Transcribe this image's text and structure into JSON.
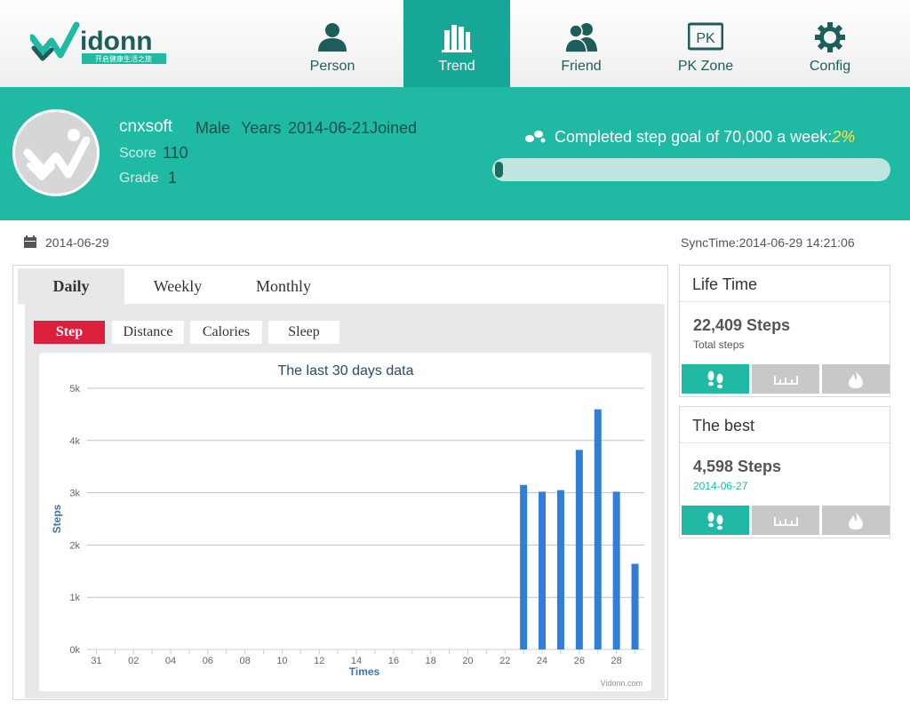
{
  "brand": {
    "name": "idonn",
    "slogan": "开启健康生活之旅"
  },
  "nav": [
    {
      "label": "Person",
      "icon": "person-icon",
      "active": false
    },
    {
      "label": "Trend",
      "icon": "bar-chart-icon",
      "active": true
    },
    {
      "label": "Friend",
      "icon": "friends-icon",
      "active": false
    },
    {
      "label": "PK Zone",
      "icon": "pk-icon",
      "icon_text": "PK",
      "active": false
    },
    {
      "label": "Config",
      "icon": "gear-icon",
      "active": false
    }
  ],
  "profile": {
    "username": "cnxsoft",
    "gender": "Male",
    "years_label": "Years",
    "joined": "2014-06-21Joined",
    "score_label": "Score",
    "score": "110",
    "grade_label": "Grade",
    "grade": "1"
  },
  "goal": {
    "text": "Completed step goal of 70,000 a week:",
    "percent_label": "2%",
    "progress": 0.02
  },
  "date": "2014-06-29",
  "sync": "SyncTime:2014-06-29 14:21:06",
  "tabs": [
    "Daily",
    "Weekly",
    "Monthly"
  ],
  "subtabs": [
    "Step",
    "Distance",
    "Calories",
    "Sleep"
  ],
  "life_time": {
    "title": "Life Time",
    "value": "22,409 Steps",
    "sub": "Total steps"
  },
  "best": {
    "title": "The best",
    "value": "4,598 Steps",
    "sub": "2014-06-27"
  },
  "card_buttons": [
    "footsteps-icon",
    "ruler-icon",
    "flame-icon"
  ],
  "colors": {
    "teal": "#1fb9a4",
    "bar": "#2f7ed8",
    "active_subtab": "#dc1f3c"
  },
  "chart_data": {
    "type": "bar",
    "title": "The last 30 days data",
    "xlabel": "Times",
    "ylabel": "Steps",
    "credit": "Vidonn.com",
    "categories": [
      "31",
      "01",
      "02",
      "03",
      "04",
      "05",
      "06",
      "07",
      "08",
      "09",
      "10",
      "11",
      "12",
      "13",
      "14",
      "15",
      "16",
      "17",
      "18",
      "19",
      "20",
      "21",
      "22",
      "23",
      "24",
      "25",
      "26",
      "27",
      "28",
      "29"
    ],
    "x_tick_labels": [
      "31",
      "02",
      "04",
      "06",
      "08",
      "10",
      "12",
      "14",
      "16",
      "18",
      "20",
      "22",
      "24",
      "26",
      "28"
    ],
    "values": [
      0,
      0,
      0,
      0,
      0,
      0,
      0,
      0,
      0,
      0,
      0,
      0,
      0,
      0,
      0,
      0,
      0,
      0,
      0,
      0,
      0,
      0,
      0,
      3150,
      3020,
      3050,
      3820,
      4598,
      3020,
      1640
    ],
    "y_ticks": [
      "0k",
      "1k",
      "2k",
      "3k",
      "4k",
      "5k"
    ],
    "ylim": [
      0,
      5000
    ],
    "grid": true
  }
}
